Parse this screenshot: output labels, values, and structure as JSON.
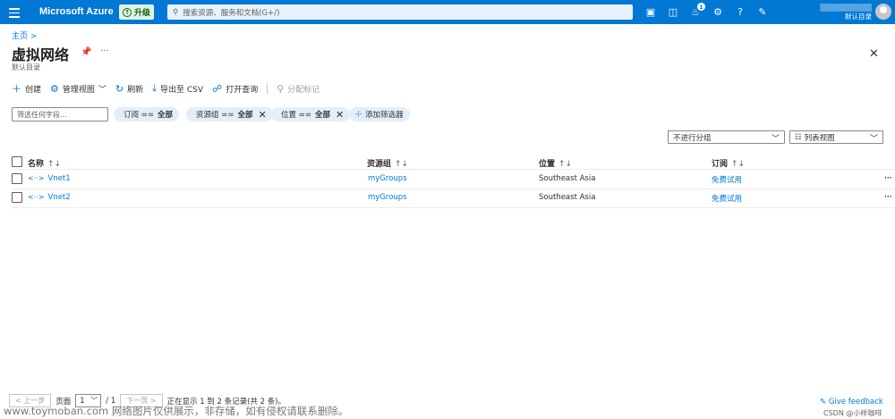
{
  "topbar": {
    "brand": "Microsoft Azure",
    "upgrade_label": "升级",
    "search_placeholder": "搜索资源、服务和文档(G+/)",
    "notification_count": "1",
    "user_directory": "默认目录"
  },
  "breadcrumb": "主页 >",
  "page": {
    "title": "虚拟网络",
    "subtitle": "默认目录"
  },
  "toolbar": {
    "create": "创建",
    "manage_view": "管理视图",
    "refresh": "刷新",
    "export_csv": "导出至 CSV",
    "open_query": "打开查询",
    "assign_tags": "分配标记"
  },
  "filters": {
    "input_placeholder": "筛选任何字段...",
    "subscription": {
      "key": "订阅 ==",
      "value": "全部"
    },
    "resource_group": {
      "key": "资源组 ==",
      "value": "全部"
    },
    "location": {
      "key": "位置 ==",
      "value": "全部"
    },
    "add_filter": "添加筛选器"
  },
  "grouping": "不进行分组",
  "view_mode": "列表视图",
  "table": {
    "headers": {
      "name": "名称",
      "resource_group": "资源组",
      "location": "位置",
      "subscription": "订阅"
    },
    "rows": [
      {
        "name": "Vnet1",
        "resource_group": "myGroups",
        "location": "Southeast Asia",
        "subscription": "免费试用"
      },
      {
        "name": "Vnet2",
        "resource_group": "myGroups",
        "location": "Southeast Asia",
        "subscription": "免费试用"
      }
    ]
  },
  "pagination": {
    "prev": "< 上一步",
    "page_label": "页面",
    "current_page": "1",
    "total": "/ 1",
    "next": "下一页 >",
    "status": "正在显示 1 到 2 条记录(共 2 条)。"
  },
  "feedback": "Give feedback",
  "watermark": "www.toymoban.com 网络图片仅供展示，非存储，如有侵权请联系删除。",
  "csdn": "CSDN @小样咖啡"
}
